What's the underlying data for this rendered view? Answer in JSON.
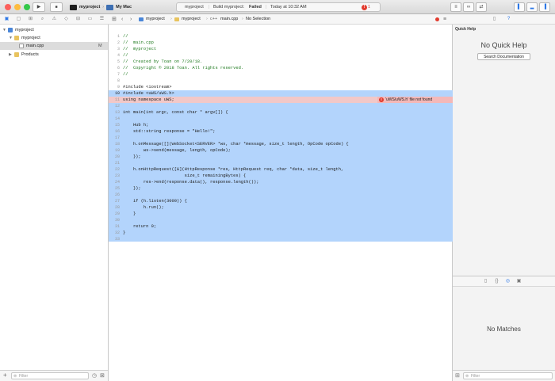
{
  "toolbar": {
    "scheme_name": "myproject",
    "destination": "My Mac",
    "activity_project": "myproject",
    "activity_status_prefix": "Build myproject:",
    "activity_status": "Failed",
    "activity_time": "Today at 10:32 AM",
    "error_count": "1",
    "run_icon": "▶",
    "stop_icon": "■"
  },
  "navigator": {
    "items": [
      {
        "label": "myproject"
      },
      {
        "label": "myproject"
      },
      {
        "label": "main.cpp",
        "badge": "M"
      },
      {
        "label": "Products"
      }
    ],
    "filter_placeholder": "Filter",
    "add_icon": "+"
  },
  "jumpbar": {
    "crumbs": [
      "myproject",
      "myproject",
      "main.cpp",
      "No Selection"
    ]
  },
  "editor": {
    "lines": [
      {
        "n": "1",
        "t": "//",
        "cls": "cm"
      },
      {
        "n": "2",
        "t": "//  main.cpp",
        "cls": "cm"
      },
      {
        "n": "3",
        "t": "//  myproject",
        "cls": "cm"
      },
      {
        "n": "4",
        "t": "//",
        "cls": "cm"
      },
      {
        "n": "5",
        "t": "//  Created by Toan on 7/20/18.",
        "cls": "cm"
      },
      {
        "n": "6",
        "t": "//  Copyright © 2018 Toan. All rights reserved.",
        "cls": "cm"
      },
      {
        "n": "7",
        "t": "//",
        "cls": "cm"
      },
      {
        "n": "8",
        "t": ""
      },
      {
        "n": "9",
        "t": "#include <iostream>"
      },
      {
        "n": "10",
        "t": "#include <uWS/uWS.h>"
      },
      {
        "n": "11",
        "t": "using namespace uWS;"
      },
      {
        "n": "12",
        "t": ""
      },
      {
        "n": "13",
        "t": "int main(int argc, const char * argv[]) {"
      },
      {
        "n": "14",
        "t": ""
      },
      {
        "n": "15",
        "t": "    Hub h;"
      },
      {
        "n": "16",
        "t": "    std::string response = \"Hello!\";"
      },
      {
        "n": "17",
        "t": ""
      },
      {
        "n": "18",
        "t": "    h.onMessage([](WebSocket<SERVER> *ws, char *message, size_t length, OpCode opCode) {"
      },
      {
        "n": "19",
        "t": "        ws->send(message, length, opCode);"
      },
      {
        "n": "20",
        "t": "    });"
      },
      {
        "n": "21",
        "t": ""
      },
      {
        "n": "22",
        "t": "    h.onHttpRequest([&](HttpResponse *res, HttpRequest req, char *data, size_t length,"
      },
      {
        "n": "23",
        "t": "                        size_t remainingBytes) {"
      },
      {
        "n": "24",
        "t": "        res->end(response.data(), response.length());"
      },
      {
        "n": "25",
        "t": "    });"
      },
      {
        "n": "26",
        "t": ""
      },
      {
        "n": "27",
        "t": "    if (h.listen(3000)) {"
      },
      {
        "n": "28",
        "t": "        h.run();"
      },
      {
        "n": "29",
        "t": "    }"
      },
      {
        "n": "30",
        "t": ""
      },
      {
        "n": "31",
        "t": "    return 0;"
      },
      {
        "n": "32",
        "t": "}"
      },
      {
        "n": "33",
        "t": ""
      }
    ],
    "error_message": "'uWS/uWS.h' file not found",
    "error_icon": "!"
  },
  "inspector": {
    "quick_help_title": "Quick Help",
    "no_help": "No Quick Help",
    "search_button": "Search Documentation",
    "no_matches": "No Matches",
    "filter_placeholder": "Filter"
  },
  "colors": {
    "selection": "#b3d4fc",
    "error": "#e23b2e",
    "comment": "#1f7a1f",
    "accent": "#2c77e6"
  }
}
